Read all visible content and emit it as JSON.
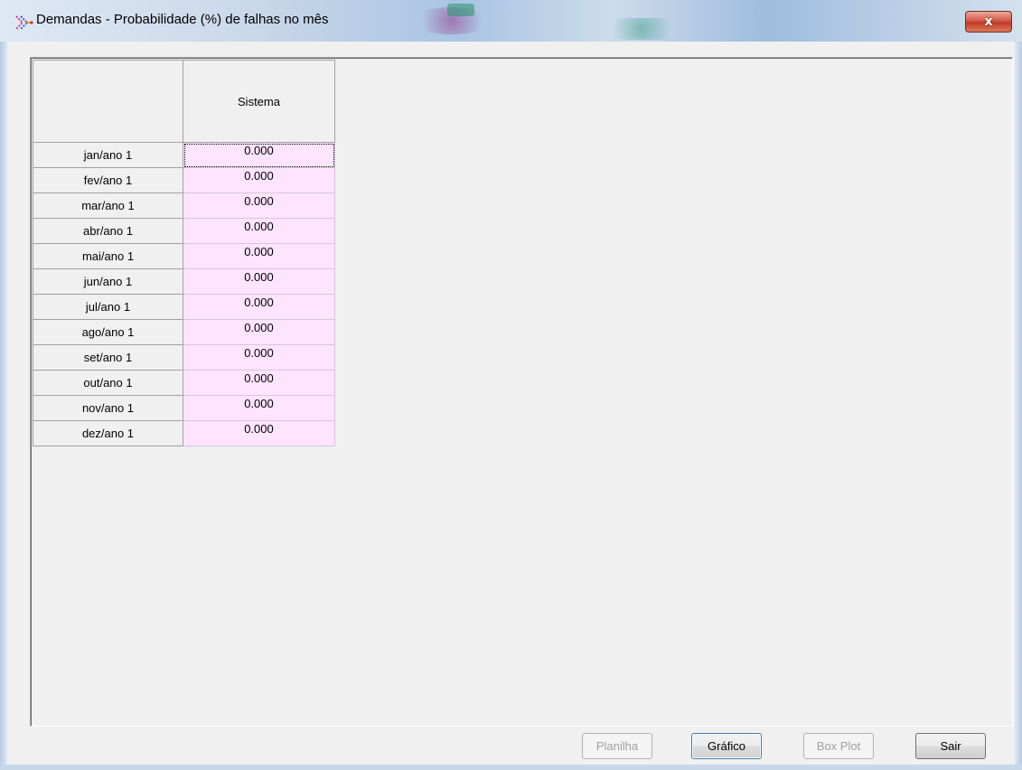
{
  "window": {
    "title": "Demandas - Probabilidade (%) de falhas no mês",
    "close_glyph": "x",
    "app_icon": "arrows-network-icon"
  },
  "grid": {
    "column_header": "Sistema",
    "rows": [
      {
        "label": "jan/ano 1",
        "value": "0.000"
      },
      {
        "label": "fev/ano 1",
        "value": "0.000"
      },
      {
        "label": "mar/ano 1",
        "value": "0.000"
      },
      {
        "label": "abr/ano 1",
        "value": "0.000"
      },
      {
        "label": "mai/ano 1",
        "value": "0.000"
      },
      {
        "label": "jun/ano 1",
        "value": "0.000"
      },
      {
        "label": "jul/ano 1",
        "value": "0.000"
      },
      {
        "label": "ago/ano 1",
        "value": "0.000"
      },
      {
        "label": "set/ano 1",
        "value": "0.000"
      },
      {
        "label": "out/ano 1",
        "value": "0.000"
      },
      {
        "label": "nov/ano 1",
        "value": "0.000"
      },
      {
        "label": "dez/ano 1",
        "value": "0.000"
      }
    ],
    "cell_color": "#ffe4ff"
  },
  "buttons": {
    "planilha": "Planilha",
    "grafico": "Gráfico",
    "boxplot": "Box Plot",
    "sair": "Sair"
  }
}
